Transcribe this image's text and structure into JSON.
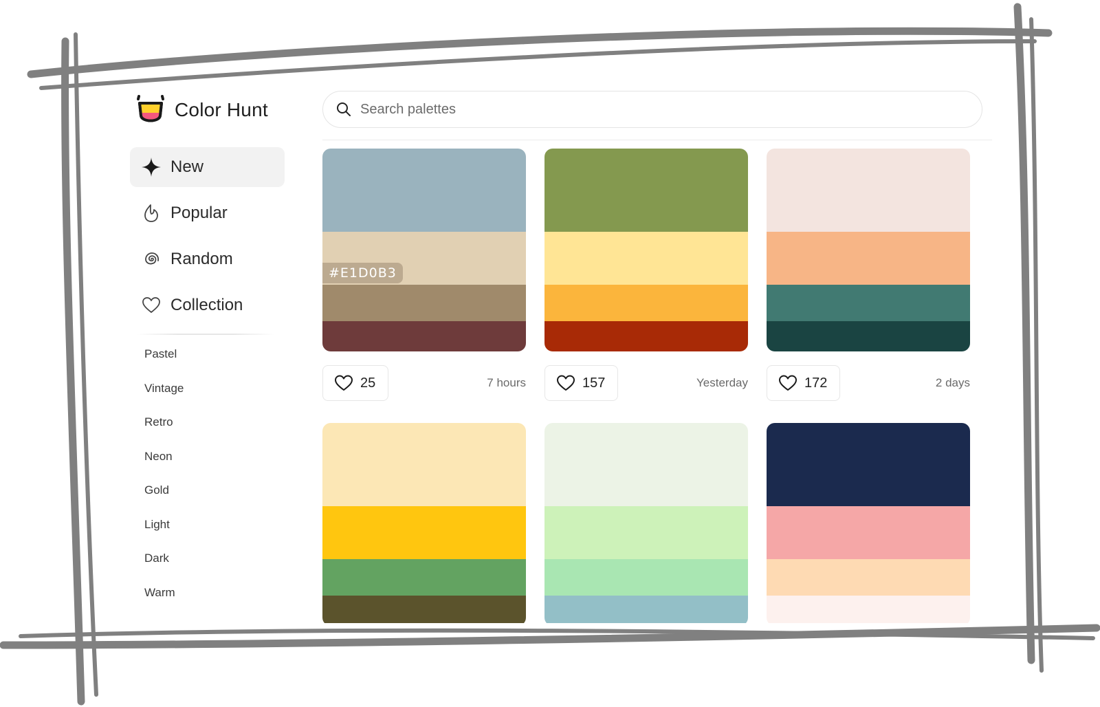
{
  "app": {
    "name": "Color Hunt",
    "logo_icon": "tongue-cup-logo"
  },
  "search": {
    "placeholder": "Search palettes",
    "icon": "search-icon"
  },
  "nav": {
    "items": [
      {
        "label": "New",
        "icon": "sparkle-icon",
        "active": true
      },
      {
        "label": "Popular",
        "icon": "flame-icon",
        "active": false
      },
      {
        "label": "Random",
        "icon": "spiral-icon",
        "active": false
      },
      {
        "label": "Collection",
        "icon": "heart-icon",
        "active": false
      }
    ],
    "tags": [
      "Pastel",
      "Vintage",
      "Retro",
      "Neon",
      "Gold",
      "Light",
      "Dark",
      "Warm"
    ]
  },
  "palettes": [
    {
      "colors": [
        "#9AB3BE",
        "#E1D0B3",
        "#A08A6B",
        "#6E3B3B"
      ],
      "hover_hex": "#E1D0B3",
      "likes": "25",
      "ago": "7 hours"
    },
    {
      "colors": [
        "#84994F",
        "#FFE595",
        "#FBB53C",
        "#A82A06"
      ],
      "likes": "157",
      "ago": "Yesterday"
    },
    {
      "colors": [
        "#F3E4DF",
        "#F7B586",
        "#417A72",
        "#1A4442"
      ],
      "likes": "172",
      "ago": "2 days"
    },
    {
      "colors": [
        "#FCE7B5",
        "#FFC60F",
        "#63A361",
        "#5B532C"
      ]
    },
    {
      "colors": [
        "#ECF3E6",
        "#CDF2B9",
        "#A9E6B2",
        "#93BFC7"
      ]
    },
    {
      "colors": [
        "#1B2A4E",
        "#F5A7A7",
        "#FEDAB3",
        "#FDF1EE"
      ]
    }
  ],
  "theme": {
    "frame_stroke": "#808080",
    "active_bg": "#F2F2F2",
    "logo_pink": "#F4587E",
    "logo_yellow": "#FFD02B"
  }
}
